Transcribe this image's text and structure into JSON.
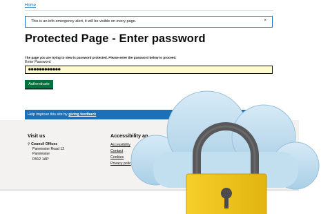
{
  "breadcrumb": {
    "home_label": "Home"
  },
  "alert": {
    "text": "This is an info emergency alert, it will be visible on every page.",
    "close_glyph": "×"
  },
  "page": {
    "title": "Protected Page - Enter password",
    "intro": "The page you are trying to view is password protected. Please enter the password below to proceed.",
    "password_label": "Enter Password",
    "password_value": "●●●●●●●●●●●●",
    "authenticate_label": "Authenticate"
  },
  "feedback": {
    "prefix": "Help improve this site by",
    "link_label": "giving feedback"
  },
  "footer": {
    "visit_heading": "Visit us",
    "address_org": "Council Offices",
    "address_lines": [
      "Parminster Road 12",
      "Parminster",
      "PA12 1AP"
    ],
    "accessibility_heading": "Accessibility an",
    "links": [
      "Accessibility",
      "Contact",
      "Cookies",
      "Privacy polic"
    ]
  },
  "colors": {
    "link_blue": "#1d70b8",
    "button_green": "#00703c",
    "input_yellow": "#fffbd0",
    "footer_grey": "#f3f2f1",
    "cloud_blue": "#b8d7ea",
    "lock_gold": "#f0c419",
    "shackle_grey": "#58585a"
  },
  "icons": {
    "address": "map-pin-icon",
    "overlay": "cloud-padlock-icon",
    "close": "close-icon"
  }
}
